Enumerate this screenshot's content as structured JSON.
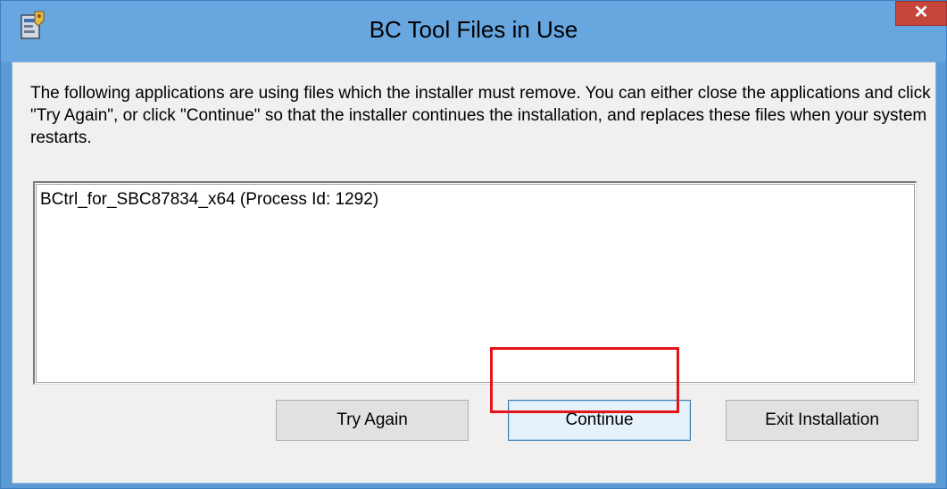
{
  "window": {
    "title": "BC Tool Files in Use",
    "close_label": "✕",
    "icon": "installer-icon"
  },
  "message": "The following applications are using files which the installer must remove. You can either close the applications and click \"Try Again\", or click \"Continue\" so that the installer continues the installation, and replaces these files when your system restarts.",
  "process_list": {
    "items": [
      "BCtrl_for_SBC87834_x64 (Process Id: 1292)"
    ]
  },
  "buttons": {
    "try_again": "Try Again",
    "continue": "Continue",
    "exit_installation": "Exit Installation"
  },
  "annotation": {
    "highlight_color": "#e3151a",
    "highlighted": "continue"
  }
}
